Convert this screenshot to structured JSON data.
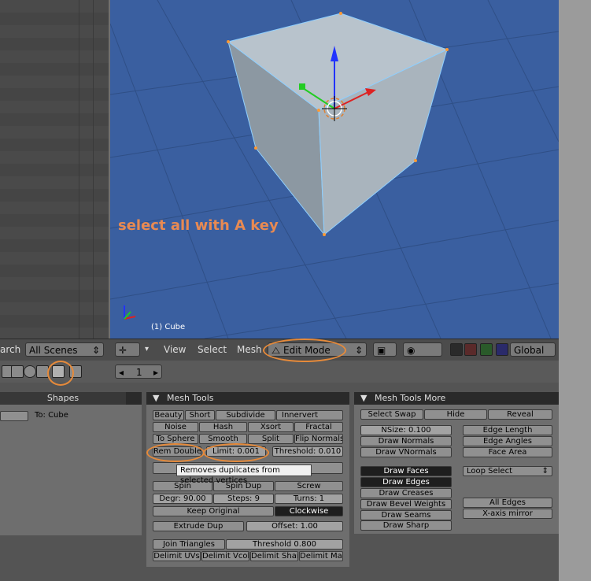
{
  "viewport": {
    "object_label": "(1) Cube",
    "instruction": "select all with A key"
  },
  "header": {
    "search_fragment": "arch",
    "scene_select": "All Scenes",
    "menu_view": "View",
    "menu_select": "Select",
    "menu_mesh": "Mesh",
    "mode_select": "Edit Mode",
    "orientation": "Global"
  },
  "toolbar2": {
    "frame_number": "1"
  },
  "left_panel": {
    "tab_shapes": "Shapes",
    "to_label": "To: Cube"
  },
  "mesh_tools": {
    "title": "Mesh Tools",
    "row1": [
      "Beauty",
      "Short",
      "Subdivide",
      "Innervert"
    ],
    "row2": [
      "Noise",
      "Hash",
      "Xsort",
      "Fractal"
    ],
    "row3": [
      "To Sphere",
      "Smooth",
      "Split",
      "Flip Normals"
    ],
    "rem_double": "Rem Double",
    "limit": "Limit: 0.001",
    "threshold": "Threshold: 0.010",
    "tooltip": "Removes duplicates from selected vertices",
    "spin": "Spin",
    "spin_dup": "Spin Dup",
    "screw": "Screw",
    "degr": "Degr: 90.00",
    "steps": "Steps: 9",
    "turns": "Turns: 1",
    "keep_original": "Keep Original",
    "clockwise": "Clockwise",
    "extrude_dup": "Extrude Dup",
    "offset": "Offset: 1.00",
    "join_triangles": "Join Triangles",
    "join_threshold": "Threshold 0.800",
    "delimit": [
      "Delimit UVs",
      "Delimit Vcol",
      "Delimit Shar",
      "Delimit Mat"
    ]
  },
  "mesh_tools_more": {
    "title": "Mesh Tools More",
    "select_swap": "Select Swap",
    "hide": "Hide",
    "reveal": "Reveal",
    "nsize": "NSize: 0.100",
    "draw_normals": "Draw Normals",
    "draw_vnormals": "Draw VNormals",
    "edge_length": "Edge Length",
    "edge_angles": "Edge Angles",
    "face_area": "Face Area",
    "draw_faces": "Draw Faces",
    "draw_edges": "Draw Edges",
    "draw_creases": "Draw Creases",
    "draw_bevel": "Draw Bevel Weights",
    "draw_seams": "Draw Seams",
    "draw_sharp": "Draw Sharp",
    "loop_select": "Loop Select",
    "all_edges": "All Edges",
    "x_mirror": "X-axis mirror"
  },
  "colors": {
    "viewport_bg": "#3a5fa0",
    "highlight": "#e68a3a",
    "instruction": "#e88a52"
  }
}
